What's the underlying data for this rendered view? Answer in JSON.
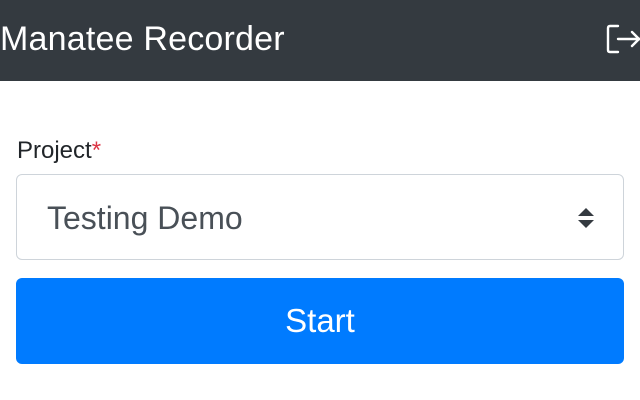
{
  "header": {
    "title": "Manatee Recorder",
    "logout_icon": "logout-icon",
    "background_color": "#343a40"
  },
  "form": {
    "project_label": "Project",
    "required_marker": "*",
    "project_select": {
      "selected_value": "Testing Demo",
      "icon": "select-arrows-icon"
    },
    "start_label": "Start",
    "start_color": "#007bff"
  }
}
